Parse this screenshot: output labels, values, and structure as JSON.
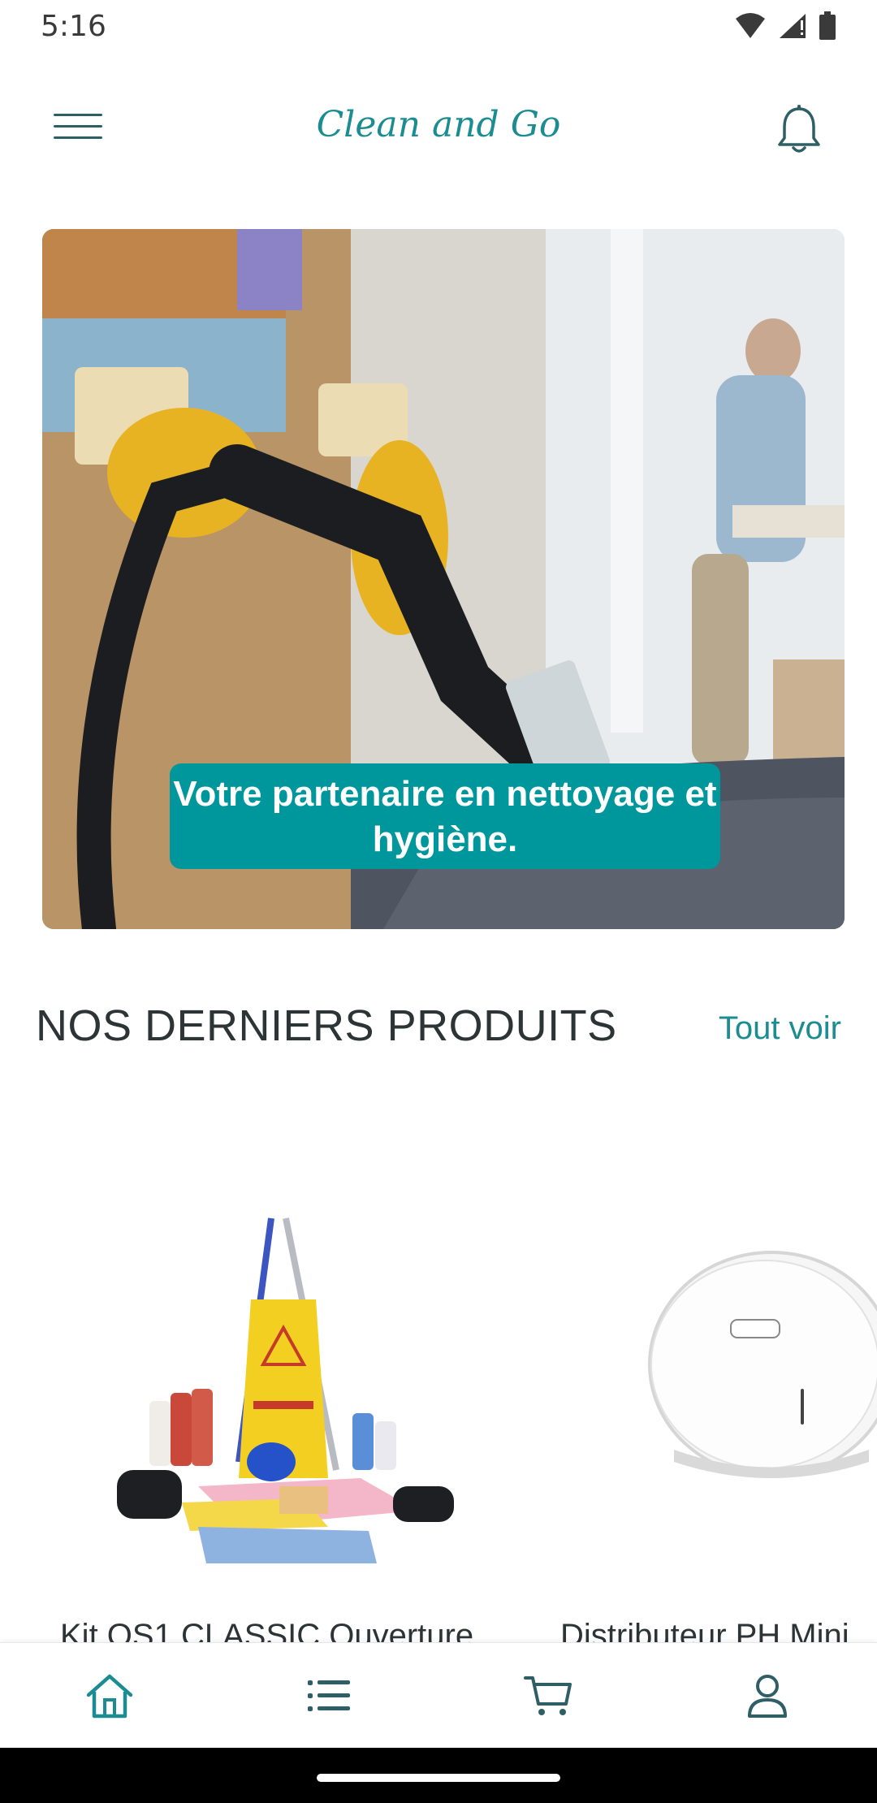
{
  "status_bar": {
    "time": "5:16"
  },
  "header": {
    "title": "Clean and Go"
  },
  "hero": {
    "caption": "Votre partenaire en nettoyage et hygiène."
  },
  "section": {
    "title": "NOS DERNIERS PRODUITS",
    "see_all": "Tout voir"
  },
  "products": [
    {
      "name": "Kit OS1 CLASSIC Ouverture"
    },
    {
      "name": "Distributeur PH Mini"
    }
  ],
  "bottom_nav": {
    "active": "home",
    "items": [
      "home",
      "catalog",
      "cart",
      "account"
    ],
    "accent": "#1b8c92"
  },
  "colors": {
    "accent": "#00979c",
    "text": "#2d3436"
  }
}
